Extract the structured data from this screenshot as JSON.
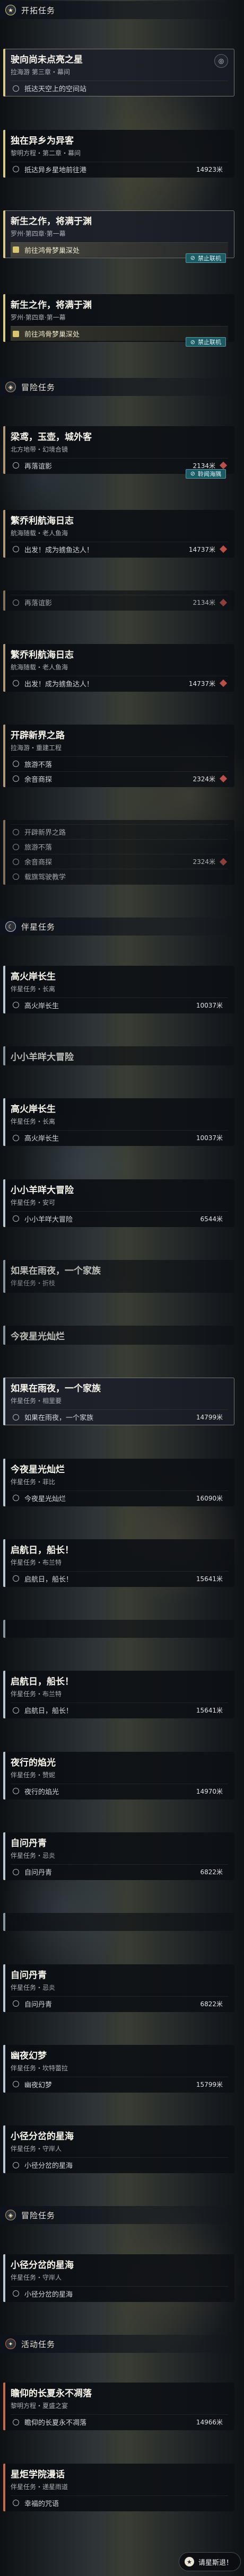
{
  "colors": {
    "trailblaze": "#d9c98a",
    "companion": "#b9c7d4",
    "adventure": "#b39673",
    "event": "#c46a4a",
    "hl": "#d8c572"
  },
  "nav_button": {
    "icon": "trailblaze-icon",
    "label": "请星斯退！"
  },
  "rows": [
    {
      "k": "sec",
      "title": "开拓任务",
      "icon": "star-icon",
      "c": "trailblaze"
    },
    {
      "k": "card",
      "c": "trailblaze",
      "sel": true,
      "pin": "◎",
      "title": "驶向尚未点亮之星",
      "sub": "拉海游 第三章・幕间",
      "objs": [
        {
          "text": "抵达天空上的空间站",
          "dist": "",
          "mark": false
        }
      ]
    },
    {
      "k": "card",
      "c": "trailblaze",
      "title": "独在异乡为异客",
      "sub": "黎明方程・第二章・幕间",
      "objs": [
        {
          "text": "抵达异乡星地前往港",
          "dist": "14923米",
          "mark": false
        }
      ]
    },
    {
      "k": "card",
      "c": "trailblaze",
      "sel": true,
      "title": "新生之作，将满于渊",
      "sub": "罗州·第四章·第一幕",
      "objs": [
        {
          "text": "前往鸿骨梦巢深处",
          "dist": "",
          "mark": false,
          "hi": true
        }
      ],
      "badge": "禁止联机"
    },
    {
      "k": "card",
      "c": "trailblaze",
      "title": "新生之作，将满于渊",
      "sub": "罗州·第四章·第一幕",
      "objs": [
        {
          "text": "前往鸿骨梦巢深处",
          "dist": "",
          "mark": false,
          "hi": true
        }
      ],
      "badge": "禁止联机"
    },
    {
      "k": "sec",
      "title": "冒险任务",
      "icon": "compass-icon",
      "c": "adventure"
    },
    {
      "k": "card",
      "c": "adventure",
      "title": "梁鸢，玉壶，城外客",
      "sub": "北方地带・幻境合镜",
      "objs": [
        {
          "text": "再落谊影",
          "dist": "2134米",
          "mark": true
        }
      ],
      "badge": "聆闻海隅"
    },
    {
      "k": "card",
      "c": "adventure",
      "title": "繁乔利航海日志",
      "sub": "航海随载・老人鱼海",
      "objs": [
        {
          "text": "出发！成为掳鱼达人！",
          "dist": "14737米",
          "mark": true
        }
      ]
    },
    {
      "k": "card",
      "c": "adventure",
      "title": "",
      "sub": "",
      "objs": [
        {
          "text": "再落谊影",
          "dist": "2134米",
          "mark": true
        }
      ],
      "fade": true
    },
    {
      "k": "card",
      "c": "adventure",
      "title": "繁乔利航海日志",
      "sub": "航海随载・老人鱼海",
      "objs": [
        {
          "text": "出发！成为掳鱼达人！",
          "dist": "14737米",
          "mark": true
        }
      ]
    },
    {
      "k": "card",
      "c": "adventure",
      "title": "开辟新界之路",
      "sub": "拉海游・重建工程",
      "objs": [
        {
          "text": "旅游不落",
          "dist": "",
          "mark": false
        },
        {
          "text": "余音商探",
          "dist": "2324米",
          "mark": true
        }
      ]
    },
    {
      "k": "card",
      "c": "adventure",
      "title": "",
      "sub": "",
      "objs": [
        {
          "text": "开辟新界之路",
          "dist": "",
          "mark": false
        },
        {
          "text": "旅游不落",
          "dist": "",
          "mark": false
        },
        {
          "text": "余音商探",
          "dist": "2324米",
          "mark": true
        },
        {
          "text": "载旗驾驶教学",
          "dist": "",
          "mark": false
        }
      ],
      "fade": true
    },
    {
      "k": "sec",
      "title": "伴星任务",
      "icon": "crescent-icon",
      "c": "companion"
    },
    {
      "k": "card",
      "c": "companion",
      "title": "高火岸长生",
      "sub": "伴星任务・长离",
      "objs": [
        {
          "text": "高火岸长生",
          "dist": "10037米",
          "mark": false
        }
      ]
    },
    {
      "k": "card",
      "c": "companion",
      "title": "小小羊咩大冒险",
      "sub": "",
      "objs": [],
      "fade": true
    },
    {
      "k": "card",
      "c": "companion",
      "title": "高火岸长生",
      "sub": "伴星任务・长离",
      "objs": [
        {
          "text": "高火岸长生",
          "dist": "10037米",
          "mark": false
        }
      ]
    },
    {
      "k": "card",
      "c": "companion",
      "title": "小小羊咩大冒险",
      "sub": "伴星任务・安可",
      "objs": [
        {
          "text": "小小羊咩大冒险",
          "dist": "6544米",
          "mark": false
        }
      ]
    },
    {
      "k": "card",
      "c": "companion",
      "title": "如果在雨夜，一个家族",
      "sub": "伴星任务・折枝",
      "objs": [],
      "fade": true
    },
    {
      "k": "card",
      "c": "companion",
      "title": "今夜星光灿烂",
      "sub": "",
      "objs": [],
      "fade": true
    },
    {
      "k": "card",
      "c": "companion",
      "sel": true,
      "title": "如果在雨夜，一个家族",
      "sub": "伴星任务・相里要",
      "objs": [
        {
          "text": "如果在雨夜，一个家族",
          "dist": "14799米",
          "mark": false
        }
      ]
    },
    {
      "k": "card",
      "c": "companion",
      "title": "今夜星光灿烂",
      "sub": "伴星任务・菲比",
      "objs": [
        {
          "text": "今夜星光灿烂",
          "dist": "16090米",
          "mark": false
        }
      ]
    },
    {
      "k": "card",
      "c": "companion",
      "title": "启航日，船长！",
      "sub": "伴星任务・布兰特",
      "objs": [
        {
          "text": "启航日，船长！",
          "dist": "15641米",
          "mark": false
        }
      ]
    },
    {
      "k": "card",
      "c": "companion",
      "title": "",
      "sub": "",
      "objs": [],
      "fade": true
    },
    {
      "k": "card",
      "c": "companion",
      "title": "启航日，船长！",
      "sub": "伴星任务・布兰特",
      "objs": [
        {
          "text": "启航日，船长！",
          "dist": "15641米",
          "mark": false
        }
      ]
    },
    {
      "k": "card",
      "c": "companion",
      "title": "夜行的焰光",
      "sub": "伴星任务・赞妮",
      "objs": [
        {
          "text": "夜行的焰光",
          "dist": "14970米",
          "mark": false
        }
      ]
    },
    {
      "k": "card",
      "c": "companion",
      "title": "自问丹青",
      "sub": "伴星任务・忌炎",
      "objs": [
        {
          "text": "自问丹青",
          "dist": "6822米",
          "mark": false
        }
      ]
    },
    {
      "k": "card",
      "c": "companion",
      "title": "",
      "sub": "",
      "objs": [],
      "fade": true
    },
    {
      "k": "card",
      "c": "companion",
      "title": "自问丹青",
      "sub": "伴星任务・忌炎",
      "objs": [
        {
          "text": "自问丹青",
          "dist": "6822米",
          "mark": false
        }
      ]
    },
    {
      "k": "card",
      "c": "companion",
      "title": "幽夜幻梦",
      "sub": "伴星任务・坎特蕾拉",
      "objs": [
        {
          "text": "幽夜幻梦",
          "dist": "15799米",
          "mark": false
        }
      ]
    },
    {
      "k": "card",
      "c": "companion",
      "title": "小径分岔的星海",
      "sub": "伴星任务・守岸人",
      "objs": [
        {
          "text": "小径分岔的星海",
          "dist": "",
          "mark": false
        }
      ]
    },
    {
      "k": "sec",
      "title": "冒险任务",
      "icon": "compass-icon",
      "c": "adventure"
    },
    {
      "k": "card",
      "c": "companion",
      "title": "小径分岔的星海",
      "sub": "伴星任务・守岸人",
      "objs": [
        {
          "text": "小径分岔的星海",
          "dist": "",
          "mark": false
        }
      ]
    },
    {
      "k": "sec",
      "title": "活动任务",
      "icon": "event-icon",
      "c": "event"
    },
    {
      "k": "card",
      "c": "event",
      "title": "瞻仰的长夏永不凋落",
      "sub": "黎明方程・夏盛之宴",
      "objs": [
        {
          "text": "瞻仰的长夏永不凋落",
          "dist": "14966米",
          "mark": false
        }
      ]
    },
    {
      "k": "card",
      "c": "event",
      "title": "星炬学院漫话",
      "sub": "伴星任务・递星雨道",
      "objs": [
        {
          "text": "幸福的咒语",
          "dist": "",
          "mark": false
        }
      ]
    }
  ]
}
